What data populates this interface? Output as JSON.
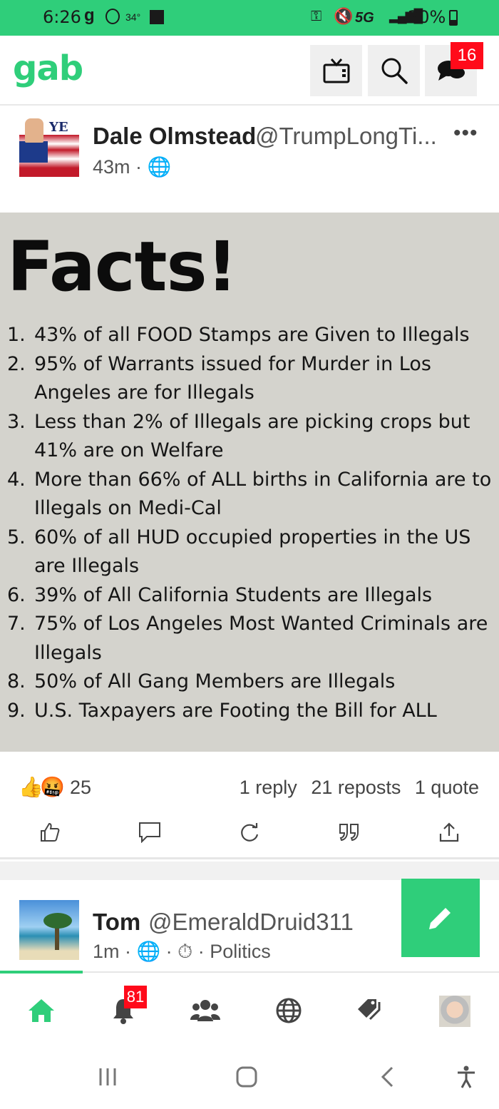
{
  "status_bar": {
    "time": "6:26",
    "carrier_glyph": "g",
    "temperature": "34°",
    "network": "5G",
    "battery": "20%"
  },
  "header": {
    "logo": "gab",
    "messages_badge": "16",
    "colors": {
      "accent": "#2fce7a",
      "badge": "#ff0a1a"
    }
  },
  "post1": {
    "author_name": "Dale Olmstead",
    "author_handle": "@TrumpLongTi...",
    "avatar_text": "YE",
    "time": "43m",
    "visibility_icon": "globe-icon",
    "image": {
      "title": "Facts!",
      "items": [
        {
          "num": "1.",
          "text": "43% of all FOOD Stamps are Given to Illegals"
        },
        {
          "num": "2.",
          "text": "95% of Warrants issued for Murder in Los Angeles are for Illegals"
        },
        {
          "num": "3.",
          "text": "Less than 2% of Illegals are picking crops but 41% are on Welfare"
        },
        {
          "num": "4.",
          "text": "More than 66% of ALL births in California are to Illegals on Medi-Cal"
        },
        {
          "num": "5.",
          "text": "60% of all HUD occupied properties in the US are Illegals"
        },
        {
          "num": "6.",
          "text": "39% of All California Students are Illegals"
        },
        {
          "num": "7.",
          "text": "75% of Los Angeles Most Wanted Criminals are Illegals"
        },
        {
          "num": "8.",
          "text": "50% of All Gang Members are Illegals"
        },
        {
          "num": "9.",
          "text": "U.S. Taxpayers are Footing the Bill for ALL"
        }
      ]
    },
    "reactions": {
      "emojis": [
        "👍",
        "🤬"
      ],
      "count": "25"
    },
    "stats": {
      "replies": "1 reply",
      "reposts": "21 reposts",
      "quotes": "1 quote"
    }
  },
  "post2": {
    "author_name": "Tom",
    "author_handle": "@EmeraldDruid311",
    "time": "1m",
    "group": "Politics"
  },
  "bottom_nav": {
    "notifications_badge": "81"
  }
}
